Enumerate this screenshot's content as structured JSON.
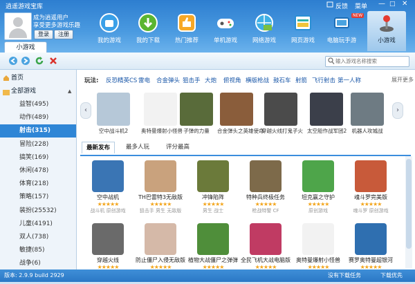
{
  "app": {
    "title": "逍遥游戏宝库",
    "win_skin": "反馈",
    "win_menu": "菜单"
  },
  "user": {
    "line1": "成为逍遥用户",
    "line2": "享受更多游戏乐趣",
    "login": "登录",
    "register": "注册"
  },
  "nav": [
    {
      "label": "我的游戏",
      "icon": "bag-icon"
    },
    {
      "label": "我的下载",
      "icon": "download-icon"
    },
    {
      "label": "热门推荐",
      "icon": "thumb-up-icon"
    },
    {
      "label": "单机游戏",
      "icon": "gamepad-icon"
    },
    {
      "label": "网络游戏",
      "icon": "globe-icon"
    },
    {
      "label": "网页游戏",
      "icon": "webpage-icon"
    },
    {
      "label": "电脑玩手游",
      "icon": "phone-icon"
    },
    {
      "label": "小游戏",
      "icon": "joystick-icon"
    }
  ],
  "new_badge": "NEW",
  "tab_label": "小游戏",
  "search_placeholder": "输入游戏名称搜索",
  "sidebar": {
    "home": "首页",
    "all": "全部游戏",
    "items": [
      "益智(495)",
      "动作(489)",
      "射击(315)",
      "冒险(228)",
      "搞笑(169)",
      "休闲(478)",
      "体育(218)",
      "策略(157)",
      "装扮(25532)",
      "儿童(4191)",
      "双人(738)",
      "敏捷(85)",
      "战争(6)"
    ],
    "selected": 2
  },
  "filter": {
    "label": "玩法:",
    "items": [
      "反恐精英CS",
      "雷电",
      "合金弹头",
      "狙击手",
      "大炮",
      "俯视角",
      "横版枪战",
      "鼓石车",
      "射箭",
      "飞行射击",
      "第一人称"
    ],
    "more": "展开更多"
  },
  "featured": [
    "空中战斗机2",
    "奥特曼爆射小怪兽",
    "子弹的力量",
    "合金弹头之英雄使命",
    "穿越火线打鬼子火",
    "太空船作战军团2",
    "机器人攻城战"
  ],
  "tabs": [
    "最新发布",
    "最多人玩",
    "评分最高"
  ],
  "games_row1": [
    {
      "name": "空中战机",
      "tags": "战斗机 原创游戏"
    },
    {
      "name": "TH巴雷特3无敌版",
      "tags": "狙击手 男生 无敌版"
    },
    {
      "name": "冲锋陷阵",
      "tags": "男生 战士"
    },
    {
      "name": "特种兵终极任务",
      "tags": "枪战特警 CF"
    },
    {
      "name": "坦克赢之守护",
      "tags": "原创游戏"
    },
    {
      "name": "魂斗罗完美版",
      "tags": "魂斗罗 原创游戏"
    }
  ],
  "games_row2": [
    "穿越火线",
    "防止僵尸入侵无敌版",
    "植物大战僵尸之弹弹",
    "全民飞机大战电脑版",
    "奥特曼爆射小怪兽",
    "赛罗奥特曼超银河"
  ],
  "stars": "★★★★★",
  "status": {
    "version": "版本: 2.9.9 build 2929",
    "no_task": "没有下载任务",
    "priority": "下载优先"
  }
}
